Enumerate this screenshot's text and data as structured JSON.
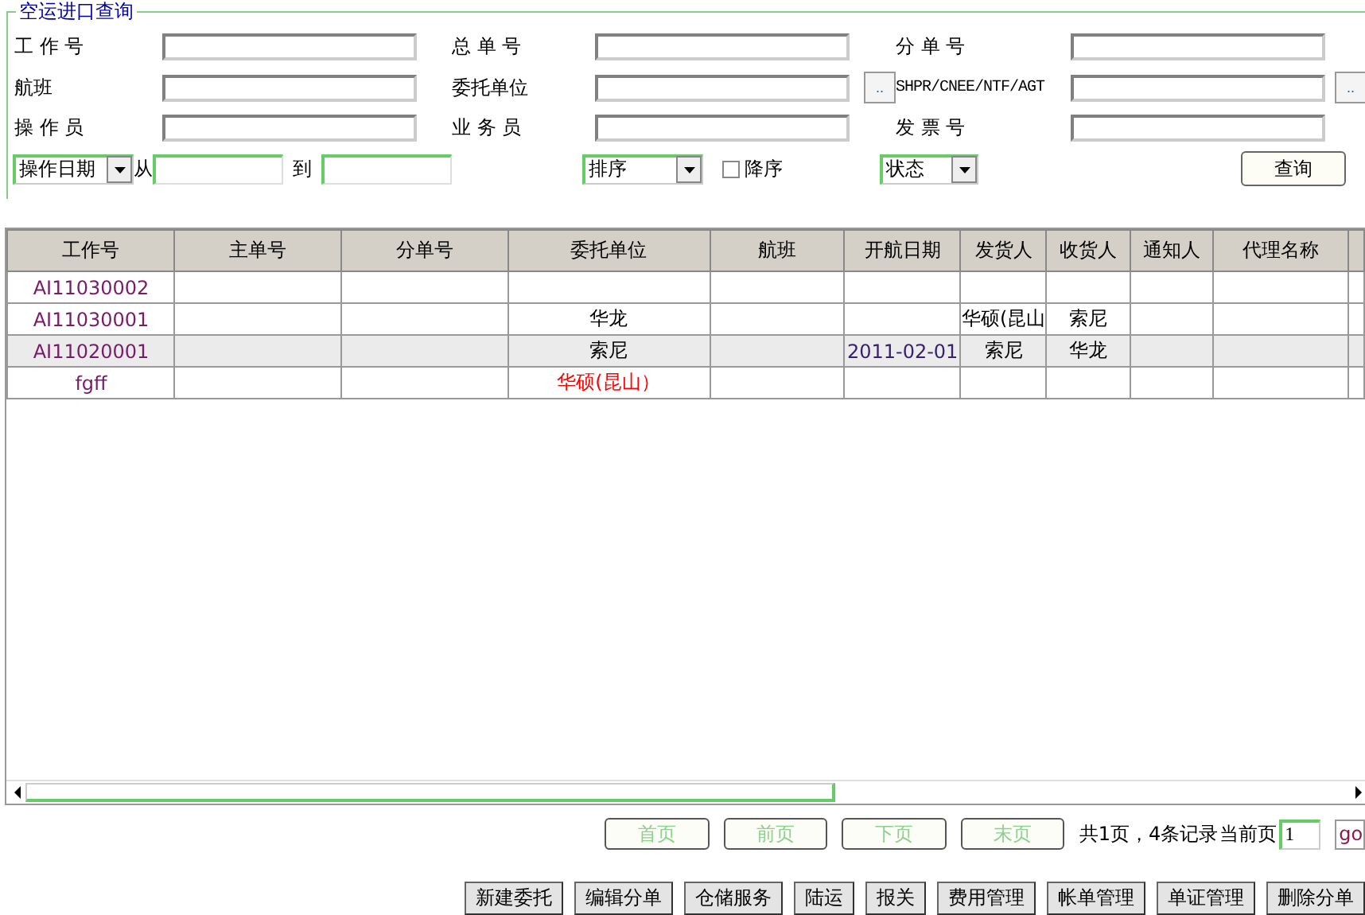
{
  "search": {
    "title": "空运进口查询",
    "fields": [
      {
        "label": "工 作 号",
        "picker": false
      },
      {
        "label": "总 单 号",
        "picker": false
      },
      {
        "label": "分 单 号",
        "picker": false
      },
      {
        "label": "航班",
        "picker": false
      },
      {
        "label": "委托单位",
        "picker": true
      },
      {
        "label": "SHPR/CNEE/NTF/AGT",
        "picker": true
      },
      {
        "label": "操 作 员",
        "picker": false
      },
      {
        "label": "业 务 员",
        "picker": false
      },
      {
        "label": "发 票 号",
        "picker": false
      }
    ],
    "date_type": "操作日期",
    "from_label": "从",
    "to_label": "到",
    "sort": "排序",
    "descending": {
      "label": "降序",
      "checked": false
    },
    "status": "状态",
    "query_button": "查询",
    "picker_button": ".."
  },
  "table": {
    "columns": [
      "工作号",
      "主单号",
      "分单号",
      "委托单位",
      "航班",
      "开航日期",
      "发货人",
      "收货人",
      "通知人",
      "代理名称"
    ],
    "rows": [
      {
        "selected": false,
        "flagged": false,
        "cells": [
          "AI11030002",
          null,
          null,
          null,
          null,
          null,
          null,
          null,
          null,
          null
        ]
      },
      {
        "selected": false,
        "flagged": false,
        "cells": [
          "AI11030001",
          null,
          null,
          "华龙",
          null,
          null,
          "华硕(昆山",
          "索尼",
          null,
          null
        ]
      },
      {
        "selected": true,
        "flagged": false,
        "cells": [
          "AI11020001",
          null,
          null,
          "索尼",
          null,
          "2011-02-01",
          "索尼",
          "华龙",
          null,
          null
        ]
      },
      {
        "selected": false,
        "flagged": true,
        "cells": [
          "fgff",
          null,
          null,
          "华硕(昆山）",
          null,
          null,
          null,
          null,
          null,
          null
        ]
      }
    ]
  },
  "pager": {
    "buttons": [
      {
        "label": "首页",
        "disabled": true
      },
      {
        "label": "前页",
        "disabled": true
      },
      {
        "label": "下页",
        "disabled": true
      },
      {
        "label": "末页",
        "disabled": true
      }
    ],
    "summary": "共1页，4条记录",
    "current_label": "当前页",
    "current_page": "1",
    "go": "go"
  },
  "actions": [
    "新建委托",
    "编辑分单",
    "仓储服务",
    "陆运",
    "报关",
    "费用管理",
    "帐单管理",
    "单证管理",
    "删除分单"
  ]
}
